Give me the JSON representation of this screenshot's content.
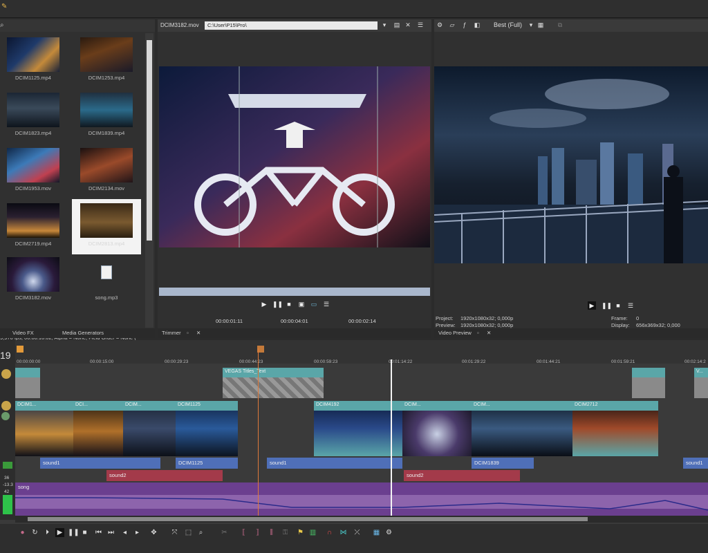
{
  "explorer": {
    "items": [
      {
        "label": "DCIM1125.mp4"
      },
      {
        "label": "DCIM1253.mp4"
      },
      {
        "label": "DCIM1823.mp4"
      },
      {
        "label": "DCIM1839.mp4"
      },
      {
        "label": "DCIM1953.mov"
      },
      {
        "label": "DCIM2134.mov"
      },
      {
        "label": "DCIM2719.mp4"
      },
      {
        "label": "DCIM2813.mp4"
      },
      {
        "label": "DCIM3182.mov"
      },
      {
        "label": "song.mp3"
      }
    ],
    "status": "9,970 fps; 00:00:16:02; Alpha = None; Field Order = None (",
    "tabs": [
      "Video FX",
      "Media Generators"
    ]
  },
  "trimmer": {
    "file": "DCIM3182.mov",
    "path": "C:\\User\\P15\\Pro\\",
    "timecodes": [
      "00:00:01:11",
      "00:00:04:01",
      "00:00:02:14"
    ],
    "footer": "Trimmer"
  },
  "preview": {
    "quality": "Best (Full)",
    "project_label": "Project:",
    "project_value": "1920x1080x32; 0,000p",
    "preview_label": "Preview:",
    "preview_value": "1920x1080x32; 0,000p",
    "frame_label": "Frame:",
    "frame_value": "0",
    "display_label": "Display:",
    "display_value": "656x369x32; 0,000",
    "footer": "Video Preview"
  },
  "timeline": {
    "track_count": "19",
    "ruler": [
      "00:00:00:00",
      "00:00:15:00",
      "00:00:29:23",
      "00:00:44:23",
      "00:00:59:23",
      "00:01:14:22",
      "00:01:29:22",
      "00:01:44:21",
      "00:01:59:21",
      "00:02:14:2"
    ],
    "title_clips": [
      "VEGAS Titles_Text",
      "V..."
    ],
    "video_clips": [
      "DCIM1...",
      "DCI...",
      "DCIM...",
      "DCIM1125",
      "DCIM4192",
      "DCIM...",
      "DCIM...",
      "DCIM2712"
    ],
    "audio_clips": [
      "sound1",
      "DCIM1125",
      "sound1",
      "DCIM1839",
      "sound1"
    ],
    "sound2_clips": [
      "sound2",
      "sound2"
    ],
    "song_label": "song",
    "vu": [
      "36",
      "-13.3",
      "42"
    ]
  },
  "colors": {
    "video_clip": "#5aa6a8",
    "audio_clip": "#4f6fb8",
    "sound2_clip": "#a33a4a",
    "song_track": "#6b3f8f"
  }
}
